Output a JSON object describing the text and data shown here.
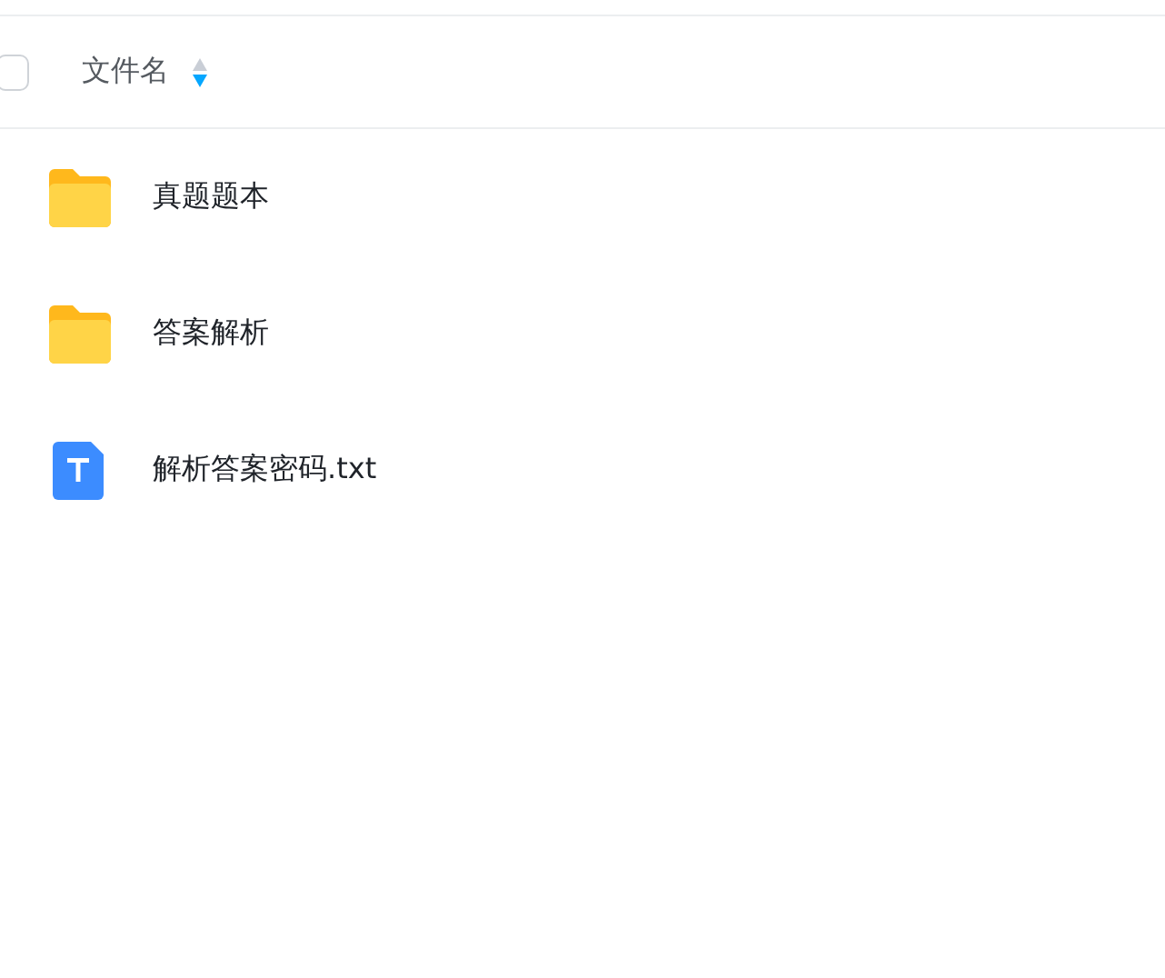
{
  "header": {
    "checked": false,
    "column_label": "文件名",
    "sort_descending": true
  },
  "files": [
    {
      "kind": "folder",
      "name": "真题题本"
    },
    {
      "kind": "folder",
      "name": "答案解析"
    },
    {
      "kind": "text",
      "name": "解析答案密码.txt"
    }
  ]
}
